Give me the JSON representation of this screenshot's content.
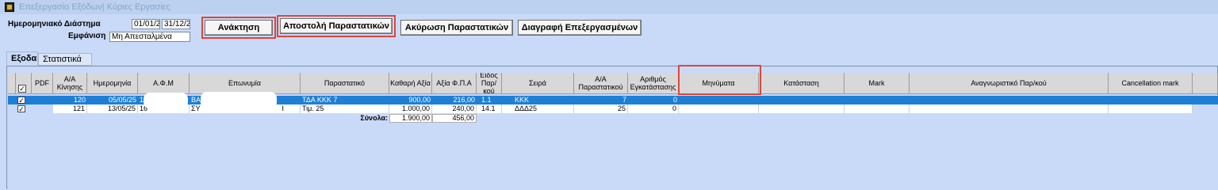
{
  "window": {
    "title": "Επεξεργασία Εξόδων| Κύριες Εργασίες",
    "icon": "app-icon"
  },
  "filters": {
    "period_label": "Ημερομηνιακό Διάστημα",
    "date_from": "01/01/25",
    "date_to": "31/12/25",
    "display_label": "Εμφάνιση",
    "display_value": "Μη Απεσταλμένα"
  },
  "toolbar": {
    "retrieve_label": "Ανάκτηση",
    "send_label": "Αποστολή Παραστατικών",
    "cancel_label": "Ακύρωση Παραστατικών",
    "delete_label": "Διαγραφή Επεξεργασμένων"
  },
  "tabs": [
    {
      "label": "Εξοδα",
      "active": true
    },
    {
      "label": "Στατιστικά",
      "active": false
    }
  ],
  "table": {
    "columns": {
      "pdf": "PDF",
      "aa_kinisis": "Α/Α Κίνησης",
      "date": "Ημερομηνία",
      "afm": "Α.Φ.Μ",
      "name": "Επωνυμία",
      "doc": "Παραστατικό",
      "net": "Καθαρή Αξία",
      "vat": "Αξία Φ.Π.Α",
      "kind": "Είδος Παρ/κού",
      "series": "Σειρά",
      "aa_doc": "Α/Α Παραστατικού",
      "install": "Αριθμός Εγκατάστασης",
      "messages": "Μηνύματα",
      "status": "Κατάσταση",
      "mark": "Mark",
      "doc_id": "Αναγνωριστικό Παρ/κού",
      "cancel_mark": "Cancellation mark"
    },
    "rows": [
      {
        "checked": true,
        "selected": true,
        "aa_kinisis": "120",
        "date": "05/05/25",
        "afm": "14",
        "name": "ΒΑ",
        "doc": "ΤΔΑ ΚΚΚ 7",
        "net": "900,00",
        "vat": "216,00",
        "kind": "1.1",
        "series": "ΚΚΚ",
        "aa_doc": "7",
        "install": "0"
      },
      {
        "checked": true,
        "selected": false,
        "aa_kinisis": "121",
        "date": "13/05/25",
        "afm": "16",
        "name": "ΣΥ",
        "name_tail": "Ι",
        "doc": "Τιμ. 25",
        "net": "1.000,00",
        "vat": "240,00",
        "kind": "14.1",
        "series": "ΔΔΔ25",
        "aa_doc": "25",
        "install": "0"
      }
    ],
    "totals": {
      "label": "Σύνολα:",
      "net": "1.900,00",
      "vat": "456,00"
    }
  },
  "colors": {
    "background": "#c9daf8",
    "selection": "#1e7fd6",
    "highlight": "#e0443a"
  }
}
